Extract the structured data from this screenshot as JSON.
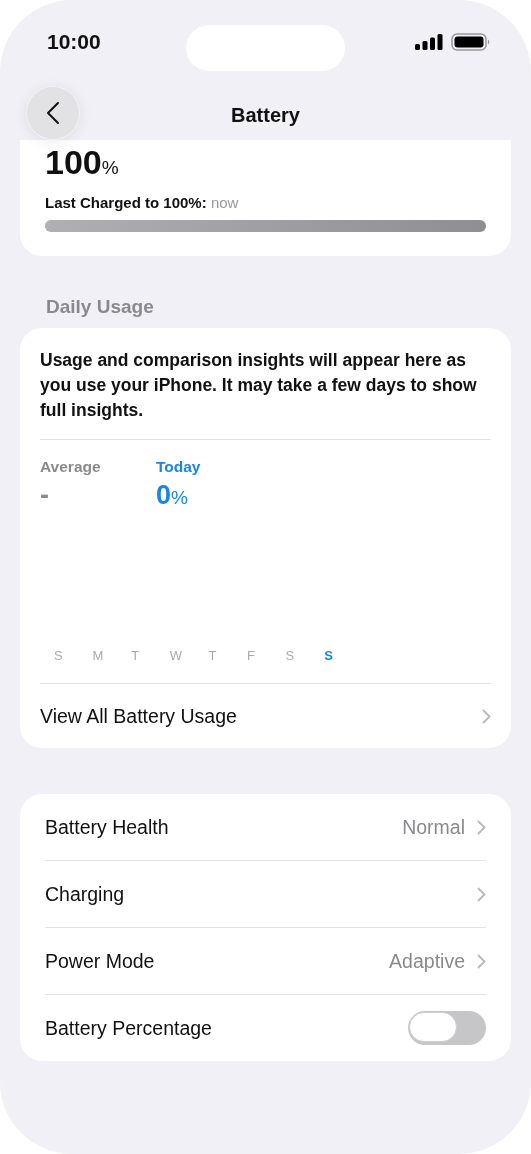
{
  "status_bar": {
    "time": "10:00"
  },
  "nav": {
    "title": "Battery"
  },
  "charge": {
    "value": "100",
    "unit": "%",
    "label": "Last Charged to 100%:",
    "time": "now",
    "level": 1
  },
  "daily_usage": {
    "header": "Daily Usage",
    "message": "Usage and comparison insights will appear here as you use your iPhone. It may take a few days to show full insights.",
    "stats": [
      {
        "label": "Average",
        "value": "-",
        "selected": false
      },
      {
        "label": "Today",
        "value": "0",
        "unit": "%",
        "selected": true
      }
    ],
    "days": [
      {
        "label": "S",
        "selected": false
      },
      {
        "label": "M",
        "selected": false
      },
      {
        "label": "T",
        "selected": false
      },
      {
        "label": "W",
        "selected": false
      },
      {
        "label": "T",
        "selected": false
      },
      {
        "label": "F",
        "selected": false
      },
      {
        "label": "S",
        "selected": false
      },
      {
        "label": "S",
        "selected": true
      }
    ],
    "link": "View All Battery Usage"
  },
  "settings": [
    {
      "kind": "link",
      "label": "Battery Health",
      "value": "Normal"
    },
    {
      "kind": "link",
      "label": "Charging"
    },
    {
      "kind": "link",
      "label": "Power Mode",
      "value": "Adaptive"
    },
    {
      "kind": "toggle",
      "label": "Battery Percentage",
      "on": false
    }
  ]
}
